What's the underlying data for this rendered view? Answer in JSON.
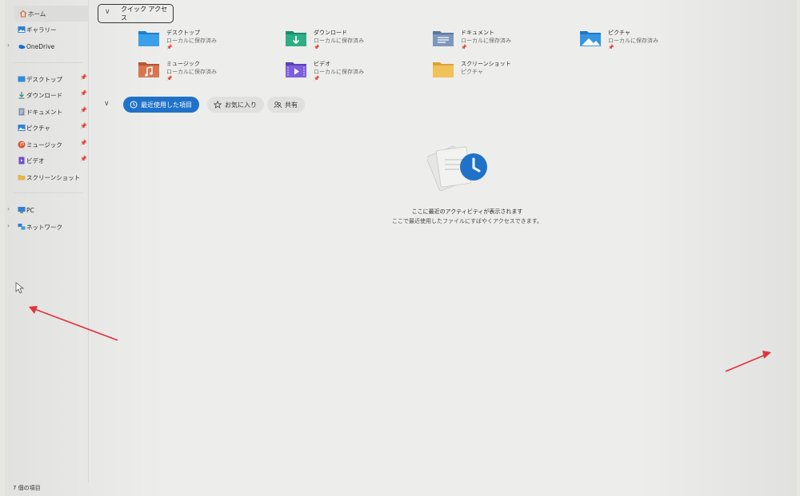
{
  "sidebar": {
    "items": [
      {
        "label": "ホーム",
        "icon": "home-icon",
        "selected": true
      },
      {
        "label": "ギャラリー",
        "icon": "gallery-icon"
      },
      {
        "label": "OneDrive",
        "icon": "onedrive-icon",
        "expandable": true
      }
    ],
    "pinned": [
      {
        "label": "デスクトップ",
        "icon": "desktop-icon"
      },
      {
        "label": "ダウンロード",
        "icon": "download-icon"
      },
      {
        "label": "ドキュメント",
        "icon": "document-icon"
      },
      {
        "label": "ピクチャ",
        "icon": "pictures-icon"
      },
      {
        "label": "ミュージック",
        "icon": "music-icon"
      },
      {
        "label": "ビデオ",
        "icon": "video-icon"
      },
      {
        "label": "スクリーンショット",
        "icon": "folder-icon"
      }
    ],
    "devices": [
      {
        "label": "PC",
        "icon": "pc-icon"
      },
      {
        "label": "ネットワーク",
        "icon": "network-icon"
      }
    ]
  },
  "quick_access": {
    "header": "クイック アクセス",
    "items": [
      {
        "name": "デスクトップ",
        "sub": "ローカルに保存済み",
        "icon": "desktop-folder-icon",
        "color": "#2a8fd6"
      },
      {
        "name": "ダウンロード",
        "sub": "ローカルに保存済み",
        "icon": "download-folder-icon",
        "color": "#2aa47c"
      },
      {
        "name": "ドキュメント",
        "sub": "ローカルに保存済み",
        "icon": "documents-folder-icon",
        "color": "#6f8fb8"
      },
      {
        "name": "ピクチャ",
        "sub": "ローカルに保存済み",
        "icon": "pictures-folder-icon",
        "color": "#2e8fd8"
      },
      {
        "name": "ミュージック",
        "sub": "ローカルに保存済み",
        "icon": "music-folder-icon",
        "color": "#d46f47"
      },
      {
        "name": "ビデオ",
        "sub": "ローカルに保存済み",
        "icon": "video-folder-icon",
        "color": "#7b5ed6"
      },
      {
        "name": "スクリーンショット",
        "sub": "ピクチャ",
        "icon": "screenshot-folder-icon",
        "color": "#e8b64a"
      }
    ]
  },
  "tabs": [
    {
      "label": "最近使用した項目",
      "icon": "clock-icon",
      "active": true
    },
    {
      "label": "お気に入り",
      "icon": "star-icon"
    },
    {
      "label": "共有",
      "icon": "people-icon"
    }
  ],
  "empty_state": {
    "title": "ここに最近のアクティビティが表示されます",
    "subtitle": "ここで最近使用したファイルにすばやくアクセスできます。"
  },
  "status": {
    "item_count": "7 個の項目"
  },
  "colors": {
    "accent": "#1f72c8",
    "annotation_arrow": "#e0343a"
  }
}
